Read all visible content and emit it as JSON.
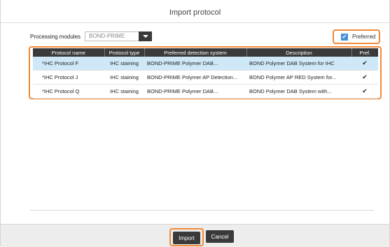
{
  "dialog": {
    "title": "Import protocol"
  },
  "processing": {
    "label": "Processing modules",
    "selected": "BOND-PRIME"
  },
  "preferred": {
    "label": "Preferred",
    "checked": true
  },
  "table": {
    "headers": [
      "Protocol name",
      "Protocol type",
      "Preferred detection system",
      "Description",
      "Pref."
    ],
    "rows": [
      {
        "name": "*IHC Protocol F",
        "type": "IHC staining",
        "detection": "BOND-PRIME Polymer DAB...",
        "description": "BOND Polymer DAB System for IHC",
        "pref": "✔"
      },
      {
        "name": "*IHC Protocol J",
        "type": "IHC staining",
        "detection": "BOND-PRIME Polymer AP Detection...",
        "description": "BOND Polymer AP RED System for...",
        "pref": "✔"
      },
      {
        "name": "*IHC Protocol Q",
        "type": "IHC staining",
        "detection": "BOND-PRIME Polymer DAB...",
        "description": "BOND Polymer DAB System with...",
        "pref": "✔"
      }
    ]
  },
  "buttons": {
    "import": "Import",
    "cancel": "Cancel"
  },
  "colors": {
    "highlight": "#f08a3a",
    "header": "#3a3a3a",
    "selected_row": "#cfe8f7",
    "checkbox": "#4a90d9"
  }
}
